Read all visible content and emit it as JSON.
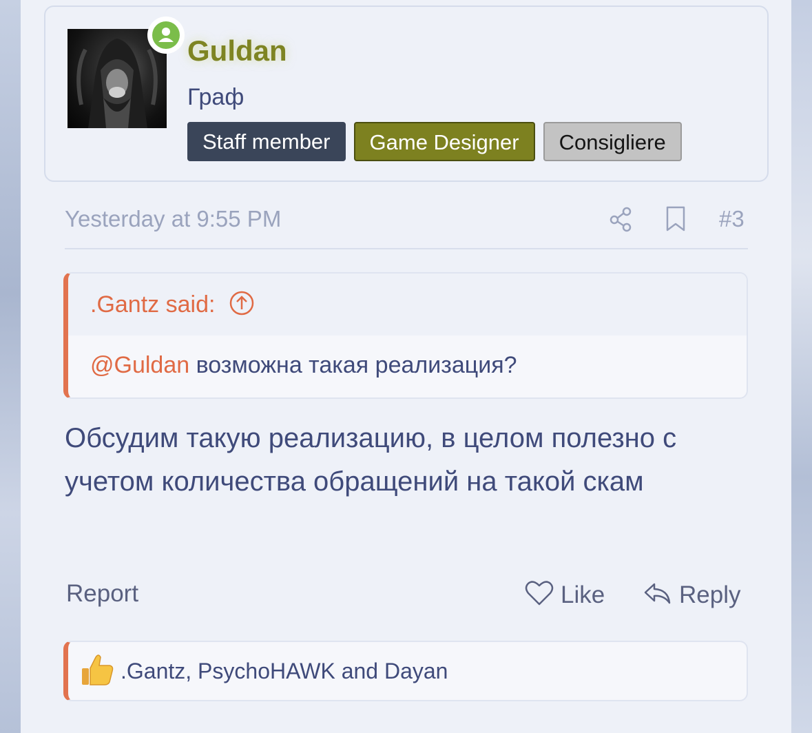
{
  "user": {
    "name": "Guldan",
    "title": "Граф",
    "badges": [
      "Staff member",
      "Game Designer",
      "Consigliere"
    ],
    "online_icon": "user-online-icon"
  },
  "meta": {
    "date": "Yesterday at 9:55 PM",
    "post_number": "#3",
    "share_icon": "share-icon",
    "bookmark_icon": "bookmark-icon"
  },
  "quote": {
    "author": ".Gantz said:",
    "arrow_icon": "arrow-up-circle-icon",
    "mention": "@Guldan",
    "text": " возможна такая реализация?"
  },
  "post": {
    "text": "Обсудим такую реализацию, в целом полезно с учетом количества обращений на такой скам"
  },
  "actions": {
    "report": "Report",
    "like": "Like",
    "reply": "Reply"
  },
  "reactions": {
    "icon": "thumbs-up-icon",
    "text": ".Gantz, PsychoHAWK and Dayan"
  },
  "colors": {
    "accent": "#e2734f",
    "username": "#7e8423",
    "text": "#3f4a7a",
    "muted": "#9aa3bd"
  }
}
